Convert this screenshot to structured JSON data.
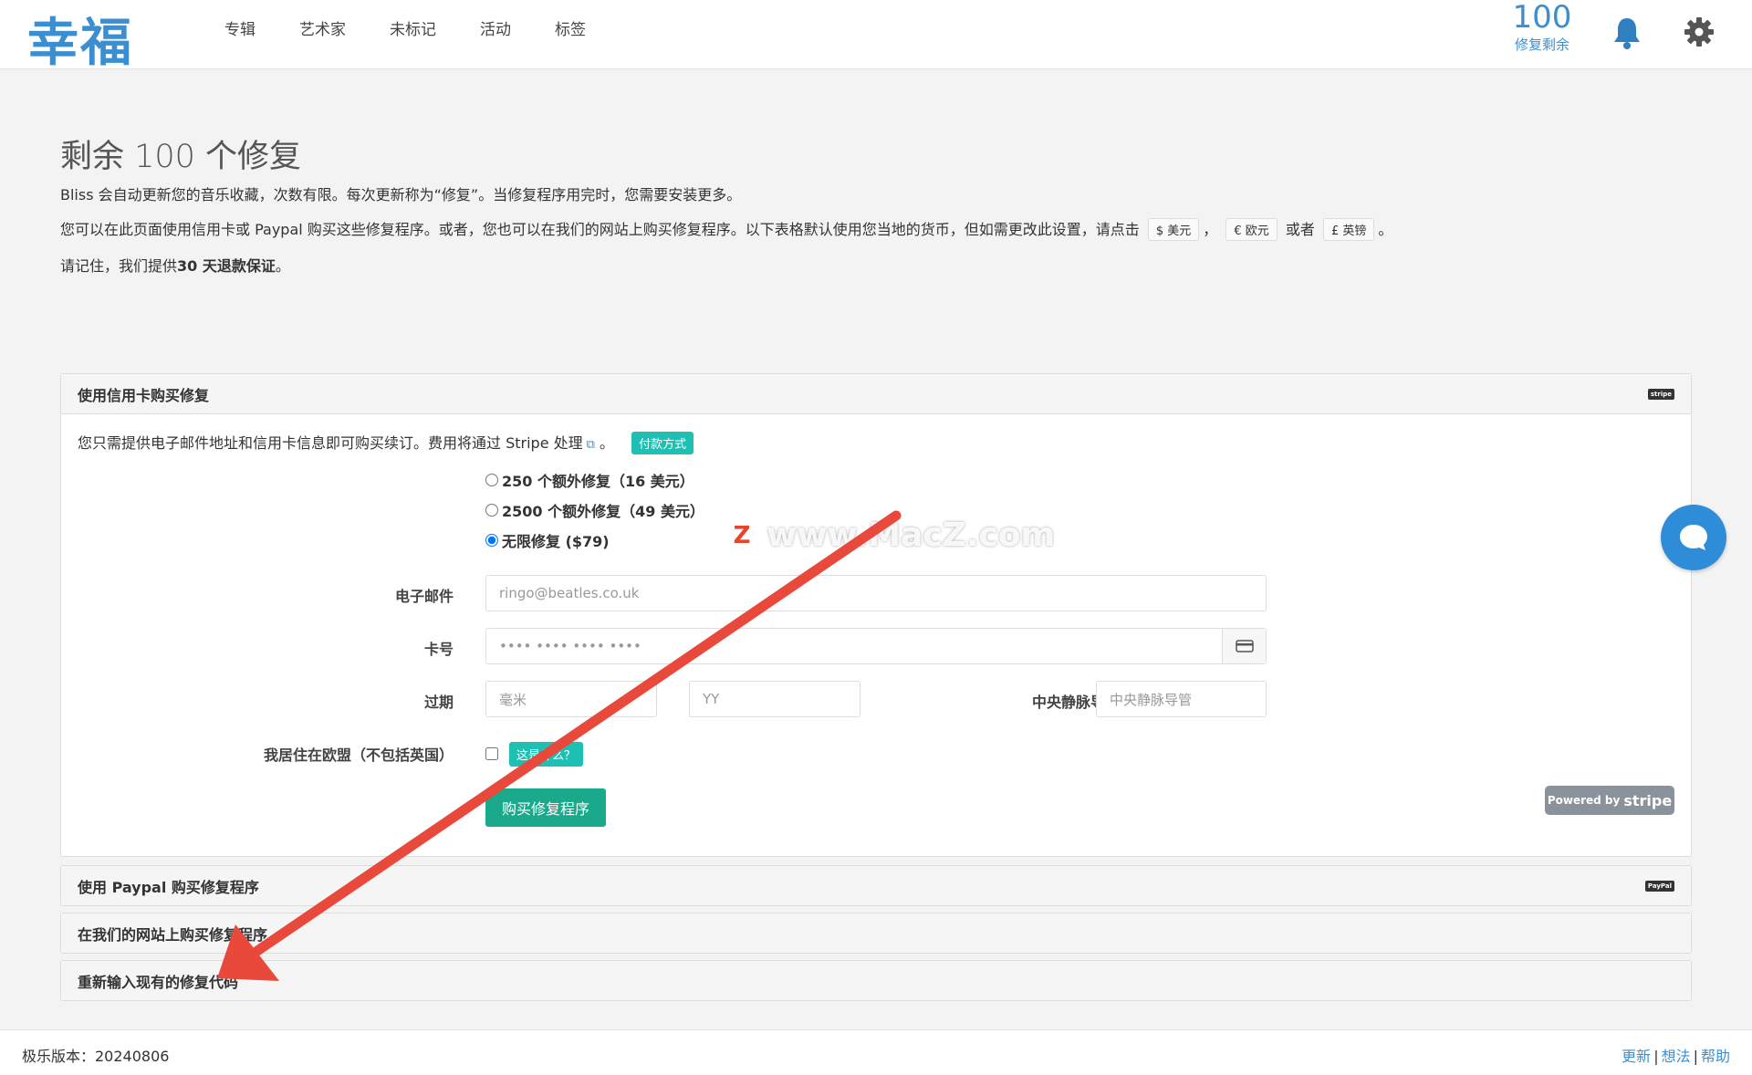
{
  "header": {
    "logo": "幸福",
    "nav": [
      "专辑",
      "艺术家",
      "未标记",
      "活动",
      "标签"
    ],
    "fix_count": "100",
    "fix_label": "修复剩余"
  },
  "intro": {
    "title": "剩余 100 个修复",
    "p1": "Bliss 会自动更新您的音乐收藏，次数有限。每次更新称为“修复”。当修复程序用完时，您需要安装更多。",
    "p2_pre": "您可以在此页面使用信用卡或 Paypal 购买这些修复程序。或者，您也可以在我们的网站上购买修复程序。以下表格默认使用您当地的货币，但如需更改此设置，请点击",
    "cur_usd": "$ 美元",
    "comma": "，",
    "cur_eur": "€ 欧元",
    "or": "或者",
    "cur_gbp": "£ 英镑",
    "period": "。",
    "p3_pre": "请记住，我们提供",
    "p3_bold": "30 天退款保证",
    "p3_post": "。"
  },
  "stripe_panel": {
    "title": "使用信用卡购买修复",
    "brand": "stripe",
    "desc": "您只需提供电子邮件地址和信用卡信息即可购买续订。费用将通过 Stripe 处理",
    "desc_end": "。",
    "pay_methods": "付款方式",
    "options": [
      {
        "label": "250 个额外修复（16 美元）",
        "selected": false
      },
      {
        "label": "2500 个额外修复（49 美元）",
        "selected": false
      },
      {
        "label": "无限修复 ($79)",
        "selected": true
      }
    ],
    "email_label": "电子邮件",
    "email_placeholder": "ringo@beatles.co.uk",
    "card_label": "卡号",
    "card_placeholder": "•••• •••• •••• ••••",
    "expiry_label": "过期",
    "month_placeholder": "毫米",
    "year_placeholder": "YY",
    "cvc_label": "中央静脉导管",
    "cvc_placeholder": "中央静脉导管",
    "eu_label": "我居住在欧盟（不包括英国）",
    "eu_checked": false,
    "what_label": "这是什么？",
    "buy_label": "购买修复程序",
    "powered_pre": "Powered by",
    "powered_brand": "stripe"
  },
  "paypal_panel": {
    "title": "使用 Paypal 购买修复程序",
    "brand": "PayPal"
  },
  "website_panel": {
    "title": "在我们的网站上购买修复程序"
  },
  "reenter_panel": {
    "title": "重新输入现有的修复代码"
  },
  "watermark": {
    "badge": "Z",
    "text": "www.MacZ.com"
  },
  "footer": {
    "version": "极乐版本：20240806",
    "links": [
      "更新",
      "想法",
      "帮助"
    ]
  }
}
